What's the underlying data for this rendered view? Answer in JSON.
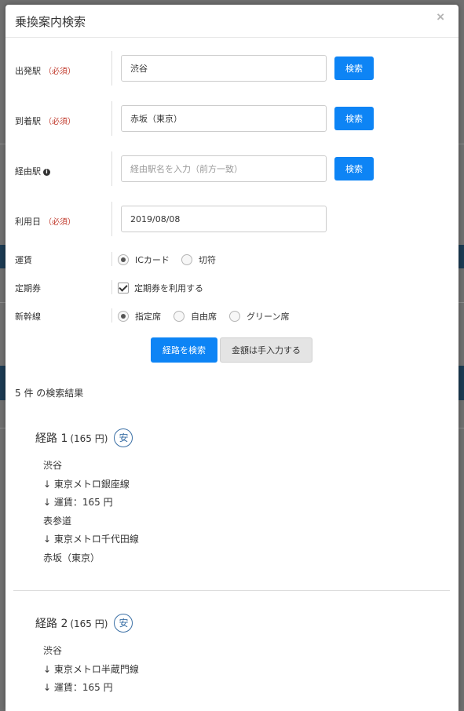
{
  "modal": {
    "title": "乗換案内検索",
    "close_label": "×"
  },
  "form": {
    "required_mark": "（必須）",
    "search_button": "検索",
    "departure": {
      "label": "出発駅",
      "value": "渋谷"
    },
    "arrival": {
      "label": "到着駅",
      "value": "赤坂（東京）"
    },
    "via": {
      "label": "経由駅",
      "info_icon": "info-icon",
      "value": "",
      "placeholder": "経由駅名を入力（前方一致）"
    },
    "date": {
      "label": "利用日",
      "value": "2019/08/08"
    },
    "fare": {
      "label": "運賃",
      "options": [
        "ICカード",
        "切符"
      ],
      "selected": "ICカード"
    },
    "pass": {
      "label": "定期券",
      "checkbox_label": "定期券を利用する",
      "checked": true
    },
    "shinkansen": {
      "label": "新幹線",
      "options": [
        "指定席",
        "自由席",
        "グリーン席"
      ],
      "selected": "指定席"
    },
    "submit_button": "経路を検索",
    "manual_button": "金額は手入力する"
  },
  "results": {
    "count_text": "5 件 の検索結果",
    "cheap_badge": "安",
    "routes": [
      {
        "title": "経路 1",
        "price": "(165  円)",
        "steps": [
          "渋谷",
          "↓ 東京メトロ銀座線",
          "↓ 運賃：165  円",
          "表参道",
          "↓ 東京メトロ千代田線",
          "赤坂（東京）"
        ]
      },
      {
        "title": "経路 2",
        "price": "(165  円)",
        "steps": [
          "渋谷",
          "↓ 東京メトロ半蔵門線",
          "↓ 運賃：165  円"
        ]
      }
    ]
  },
  "colors": {
    "primary": "#0d84f5",
    "required": "#c0392b",
    "badge": "#3a6fa5"
  }
}
